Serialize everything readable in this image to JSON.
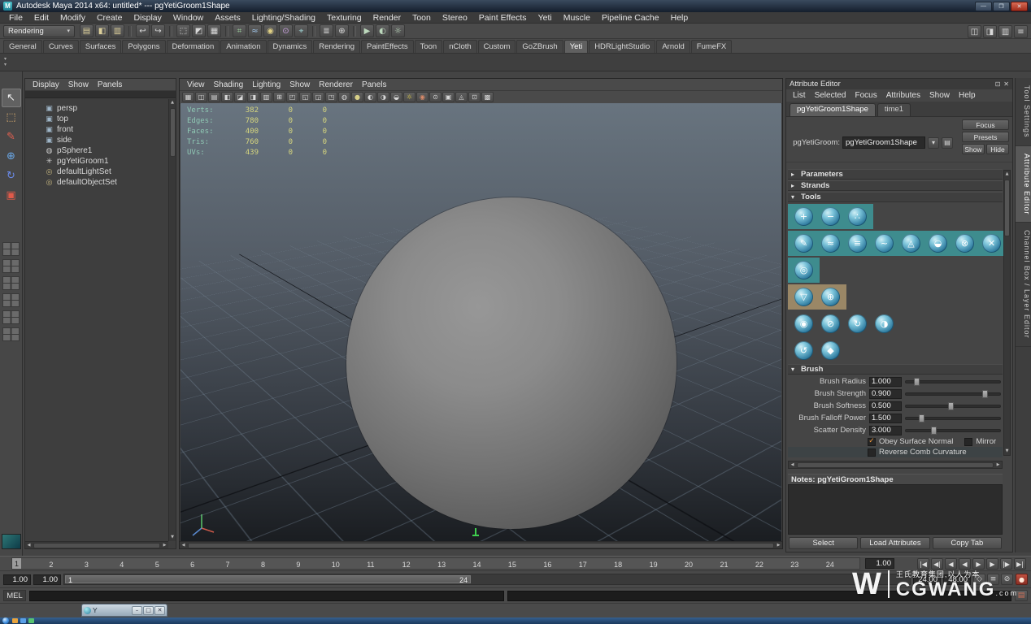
{
  "window": {
    "title": "Autodesk Maya 2014 x64: untitled*  ---  pgYetiGroom1Shape",
    "logo": "M",
    "buttons": {
      "min": "—",
      "max": "❐",
      "close": "✕"
    }
  },
  "glyphs": {
    "up": "▲",
    "down": "▼",
    "left": "◀",
    "right": "▶",
    "caret": "▾",
    "check": "✓",
    "close": "✕",
    "pin": "⊡"
  },
  "menubar": {
    "items": [
      "File",
      "Edit",
      "Modify",
      "Create",
      "Display",
      "Window",
      "Assets",
      "Lighting/Shading",
      "Texturing",
      "Render",
      "Toon",
      "Stereo",
      "Paint Effects",
      "Yeti",
      "Muscle",
      "Pipeline Cache",
      "Help"
    ]
  },
  "statusline": {
    "menuset": "Rendering",
    "icons": [
      {
        "g": "▤",
        "c": "#dccf9a",
        "n": "new-scene-icon"
      },
      {
        "g": "◧",
        "c": "#dccf9a",
        "n": "open-scene-icon"
      },
      {
        "g": "▥",
        "c": "#dccf9a",
        "n": "save-scene-icon"
      },
      {
        "d": true,
        "g": "↩",
        "c": "#d8d8d8",
        "n": "undo-icon"
      },
      {
        "g": "↪",
        "c": "#d8d8d8",
        "n": "redo-icon"
      },
      {
        "d": true,
        "g": "⬚",
        "c": "#d8d8d8",
        "n": "select-by-hierarchy-icon"
      },
      {
        "g": "◩",
        "c": "#d8d8d8",
        "n": "select-by-object-icon"
      },
      {
        "g": "▦",
        "c": "#d8d8d8",
        "n": "select-by-component-icon"
      },
      {
        "d": true,
        "g": "⌗",
        "c": "#9fd49f",
        "n": "snap-to-grid-icon"
      },
      {
        "g": "≈",
        "c": "#9fc4e8",
        "n": "snap-to-curve-icon"
      },
      {
        "g": "◉",
        "c": "#e0d084",
        "n": "snap-to-point-icon"
      },
      {
        "g": "⊙",
        "c": "#c9a0e0",
        "n": "snap-to-view-plane-icon"
      },
      {
        "g": "⌖",
        "c": "#9fd4d4",
        "n": "make-live-icon"
      },
      {
        "d": true,
        "g": "≣",
        "c": "#d8d8d8",
        "n": "input-connections-icon"
      },
      {
        "g": "⊕",
        "c": "#d8d8d8",
        "n": "construction-history-icon"
      },
      {
        "d": true,
        "g": "▶",
        "c": "#bcd8bc",
        "n": "render-current-frame-icon"
      },
      {
        "g": "◐",
        "c": "#bcd8bc",
        "n": "ipr-render-icon"
      },
      {
        "g": "☼",
        "c": "#bcd8bc",
        "n": "render-settings-icon"
      }
    ],
    "right": [
      {
        "g": "◫",
        "n": "single-pane-toggle-icon"
      },
      {
        "g": "◨",
        "n": "attribute-editor-toggle-icon"
      },
      {
        "g": "▥",
        "n": "tool-settings-toggle-icon"
      },
      {
        "g": "≡",
        "n": "channel-box-toggle-icon"
      }
    ]
  },
  "shelf": {
    "tabs": [
      {
        "label": "General"
      },
      {
        "label": "Curves"
      },
      {
        "label": "Surfaces"
      },
      {
        "label": "Polygons"
      },
      {
        "label": "Deformation"
      },
      {
        "label": "Animation"
      },
      {
        "label": "Dynamics"
      },
      {
        "label": "Rendering"
      },
      {
        "label": "PaintEffects"
      },
      {
        "label": "Toon"
      },
      {
        "label": "nCloth"
      },
      {
        "label": "Custom"
      },
      {
        "label": "GoZBrush"
      },
      {
        "label": "Yeti",
        "active": true
      },
      {
        "label": "HDRLightStudio"
      },
      {
        "label": "Arnold"
      },
      {
        "label": "FumeFX"
      }
    ]
  },
  "toolbox": {
    "tools": [
      {
        "g": "↖",
        "c": "#f0f0f0",
        "n": "select-tool-icon",
        "active": true
      },
      {
        "g": "⬚",
        "c": "#e0b070",
        "n": "lasso-tool-icon"
      },
      {
        "g": "✎",
        "c": "#e06050",
        "n": "paint-select-tool-icon"
      },
      {
        "g": "⊕",
        "c": "#6aa8e8",
        "n": "move-tool-icon"
      },
      {
        "g": "↻",
        "c": "#6a8ae8",
        "n": "rotate-tool-icon"
      },
      {
        "g": "▣",
        "c": "#e05a4a",
        "n": "scale-tool-icon"
      }
    ],
    "layouts": [
      {
        "n": "layout-single-pane-button"
      },
      {
        "n": "layout-four-pane-button"
      },
      {
        "n": "layout-two-pane-side-by-side-button"
      },
      {
        "n": "layout-two-pane-stacked-button"
      },
      {
        "n": "layout-three-pane-button"
      },
      {
        "n": "layout-outliner-persp-button"
      }
    ]
  },
  "outliner": {
    "menus": [
      "Display",
      "Show",
      "Panels"
    ],
    "items": [
      {
        "label": "persp",
        "g": "▣",
        "c": "#9fb6c8",
        "in": "camera-icon"
      },
      {
        "label": "top",
        "g": "▣",
        "c": "#9fb6c8",
        "in": "camera-icon"
      },
      {
        "label": "front",
        "g": "▣",
        "c": "#9fb6c8",
        "in": "camera-icon"
      },
      {
        "label": "side",
        "g": "▣",
        "c": "#9fb6c8",
        "in": "camera-icon"
      },
      {
        "label": "pSphere1",
        "g": "◍",
        "c": "#c8c8c8",
        "in": "polygon-mesh-icon"
      },
      {
        "label": "pgYetiGroom1",
        "g": "✳",
        "c": "#c8c8c8",
        "in": "yeti-groom-node-icon"
      },
      {
        "label": "defaultLightSet",
        "g": "◎",
        "c": "#c8b880",
        "in": "set-icon"
      },
      {
        "label": "defaultObjectSet",
        "g": "◎",
        "c": "#c8b880",
        "in": "set-icon"
      }
    ]
  },
  "viewport": {
    "menus": [
      "View",
      "Shading",
      "Lighting",
      "Show",
      "Renderer",
      "Panels"
    ],
    "toolbar": [
      {
        "g": "▦",
        "n": "select-camera-icon"
      },
      {
        "g": "◫",
        "n": "lock-camera-icon"
      },
      {
        "g": "▤",
        "n": "camera-attributes-icon"
      },
      {
        "g": "◧",
        "n": "bookmark-icon"
      },
      {
        "g": "◪",
        "n": "image-plane-icon"
      },
      {
        "g": "◨",
        "n": "two-d-pan-zoom-icon"
      },
      {
        "g": "▥",
        "n": "grease-pencil-icon"
      },
      {
        "g": "⊞",
        "n": "grid-toggle-icon"
      },
      {
        "g": "◰",
        "n": "film-gate-icon"
      },
      {
        "g": "◱",
        "n": "resolution-gate-icon"
      },
      {
        "g": "◲",
        "n": "gate-mask-icon"
      },
      {
        "g": "◳",
        "n": "field-chart-icon"
      },
      {
        "g": "◍",
        "n": "safe-action-icon"
      },
      {
        "g": "●",
        "c": "#d8d088",
        "n": "safe-title-icon"
      },
      {
        "g": "◐",
        "n": "wireframe-icon"
      },
      {
        "g": "◑",
        "n": "shaded-icon"
      },
      {
        "g": "◒",
        "n": "textured-icon"
      },
      {
        "g": "☼",
        "c": "#e8d44a",
        "n": "use-all-lights-icon"
      },
      {
        "g": "◉",
        "c": "#d88a6a",
        "n": "shadows-icon"
      },
      {
        "g": "⊙",
        "n": "screen-space-ao-icon"
      },
      {
        "g": "▣",
        "n": "motion-blur-icon"
      },
      {
        "g": "◬",
        "n": "multisampling-icon"
      },
      {
        "g": "⊡",
        "n": "depth-of-field-icon"
      },
      {
        "g": "▩",
        "n": "isolate-select-icon"
      }
    ],
    "hud": [
      {
        "l": "Verts:",
        "a": "382",
        "b": "0",
        "c": "0"
      },
      {
        "l": "Edges:",
        "a": "780",
        "b": "0",
        "c": "0"
      },
      {
        "l": "Faces:",
        "a": "400",
        "b": "0",
        "c": "0"
      },
      {
        "l": "Tris:",
        "a": "760",
        "b": "0",
        "c": "0"
      },
      {
        "l": "UVs:",
        "a": "439",
        "b": "0",
        "c": "0"
      }
    ]
  },
  "attribute_editor": {
    "title": "Attribute Editor",
    "menus": [
      "List",
      "Selected",
      "Focus",
      "Attributes",
      "Show",
      "Help"
    ],
    "tabs": [
      {
        "label": "pgYetiGroom1Shape",
        "active": true
      },
      {
        "label": "time1"
      }
    ],
    "node": {
      "label": "pgYetiGroom:",
      "value": "pgYetiGroom1Shape",
      "btn1": "▾",
      "btn2": "▤"
    },
    "actions": {
      "focus": "Focus",
      "presets": "Presets",
      "show": "Show",
      "hide": "Hide"
    },
    "sections": {
      "parameters": {
        "label": "Parameters",
        "arrow": "▸"
      },
      "strands": {
        "label": "Strands",
        "arrow": "▸"
      },
      "tools": {
        "label": "Tools",
        "arrow": "▾"
      },
      "brush": {
        "label": "Brush",
        "arrow": "▾"
      }
    },
    "tools": {
      "row1": [
        {
          "g": "+",
          "n": "add-strands-tool-icon"
        },
        {
          "g": "−",
          "n": "delete-strands-tool-icon"
        },
        {
          "g": "∴",
          "n": "scatter-strands-tool-icon"
        }
      ],
      "row2": [
        {
          "g": "✎",
          "n": "comb-tool-icon"
        },
        {
          "g": "≈",
          "n": "wave-tool-icon"
        },
        {
          "g": "≡",
          "n": "straighten-tool-icon"
        },
        {
          "g": "~",
          "n": "curl-tool-icon"
        },
        {
          "g": "◬",
          "n": "clump-tool-icon"
        },
        {
          "g": "◒",
          "n": "flatten-tool-icon"
        },
        {
          "g": "⊗",
          "n": "tangle-tool-icon"
        },
        {
          "g": "✕",
          "n": "clear-tool-icon"
        }
      ],
      "row3": [
        {
          "g": "◎",
          "n": "smooth-tool-icon"
        }
      ],
      "row4": [
        {
          "g": "▽",
          "n": "direction-tool-icon"
        },
        {
          "g": "⊕",
          "n": "attract-tool-icon"
        }
      ],
      "row5": [
        {
          "g": "◉",
          "n": "density-tool-icon"
        },
        {
          "g": "⊘",
          "n": "mask-tool-icon"
        },
        {
          "g": "↻",
          "n": "twist-tool-icon"
        },
        {
          "g": "◑",
          "n": "shift-tool-icon"
        }
      ],
      "row6": [
        {
          "g": "↺",
          "n": "undo-groom-icon"
        },
        {
          "g": "◆",
          "n": "mirror-groom-icon"
        }
      ]
    },
    "brush": {
      "sliders": [
        {
          "label": "Brush Radius",
          "value": "1.000",
          "f": 0.1
        },
        {
          "label": "Brush Strength",
          "value": "0.900",
          "f": 0.9
        },
        {
          "label": "Brush Softness",
          "value": "0.500",
          "f": 0.5
        },
        {
          "label": "Brush Falloff Power",
          "value": "1.500",
          "f": 0.15
        },
        {
          "label": "Scatter Density",
          "value": "3.000",
          "f": 0.3
        }
      ],
      "checks_row1": [
        {
          "label": "Obey Surface Normal",
          "checked": true,
          "m": "✓"
        },
        {
          "label": "Mirror"
        }
      ],
      "checks_row2": [
        {
          "label": "Reverse Comb Curvature"
        }
      ]
    },
    "notes_label": "Notes: pgYetiGroom1Shape",
    "footer": [
      "Select",
      "Load Attributes",
      "Copy Tab"
    ]
  },
  "right_tabs": [
    {
      "label": "Tool Settings"
    },
    {
      "label": "Attribute Editor",
      "active": true
    },
    {
      "label": "Channel Box / Layer Editor"
    }
  ],
  "timeline": {
    "ticks": [
      "1",
      "2",
      "3",
      "4",
      "5",
      "6",
      "7",
      "8",
      "9",
      "10",
      "11",
      "12",
      "13",
      "14",
      "15",
      "16",
      "17",
      "18",
      "19",
      "20",
      "21",
      "22",
      "23",
      "24"
    ],
    "current": "1",
    "time_field": "1.00",
    "playback": [
      {
        "g": "|◀",
        "n": "go-to-start-button"
      },
      {
        "g": "◀|",
        "n": "step-back-frame-button"
      },
      {
        "g": "◀",
        "n": "step-back-key-button"
      },
      {
        "g": "◀",
        "n": "play-backwards-button"
      },
      {
        "g": "▶",
        "n": "play-forwards-button"
      },
      {
        "g": "▶",
        "n": "step-forward-key-button"
      },
      {
        "g": "|▶",
        "n": "step-forward-frame-button"
      },
      {
        "g": "▶|",
        "n": "go-to-end-button"
      }
    ]
  },
  "range": {
    "fields_left": [
      "1.00",
      "1.00"
    ],
    "bar_start": "1",
    "bar_end": "24",
    "fields_right": [
      "24.00",
      "48.00"
    ],
    "icons": [
      {
        "g": "◇",
        "n": "character-set-icon"
      },
      {
        "g": "≡",
        "n": "anim-layer-icon"
      },
      {
        "g": "⊘",
        "n": "mute-playback-icon"
      }
    ],
    "autokey_glyph": "●"
  },
  "command_line": {
    "label": "MEL",
    "icon_glyph": "▤"
  },
  "floating_window": {
    "title": "Y",
    "buttons": [
      {
        "g": "–",
        "n": "floating-minimize-button"
      },
      {
        "g": "□",
        "n": "floating-restore-button"
      },
      {
        "g": "✕",
        "n": "floating-close-button"
      }
    ]
  },
  "watermark": {
    "logo": "W",
    "cn": "王氏教育集团,以人为本",
    "brand": "CGWANG",
    "tld": ".com"
  },
  "taskbar": {
    "icons": [
      {
        "c": "#e8a33c",
        "n": "taskbar-app-icon-1"
      },
      {
        "c": "#5aa0e8",
        "n": "taskbar-app-icon-2"
      },
      {
        "c": "#58c470",
        "n": "taskbar-app-icon-3"
      }
    ]
  }
}
